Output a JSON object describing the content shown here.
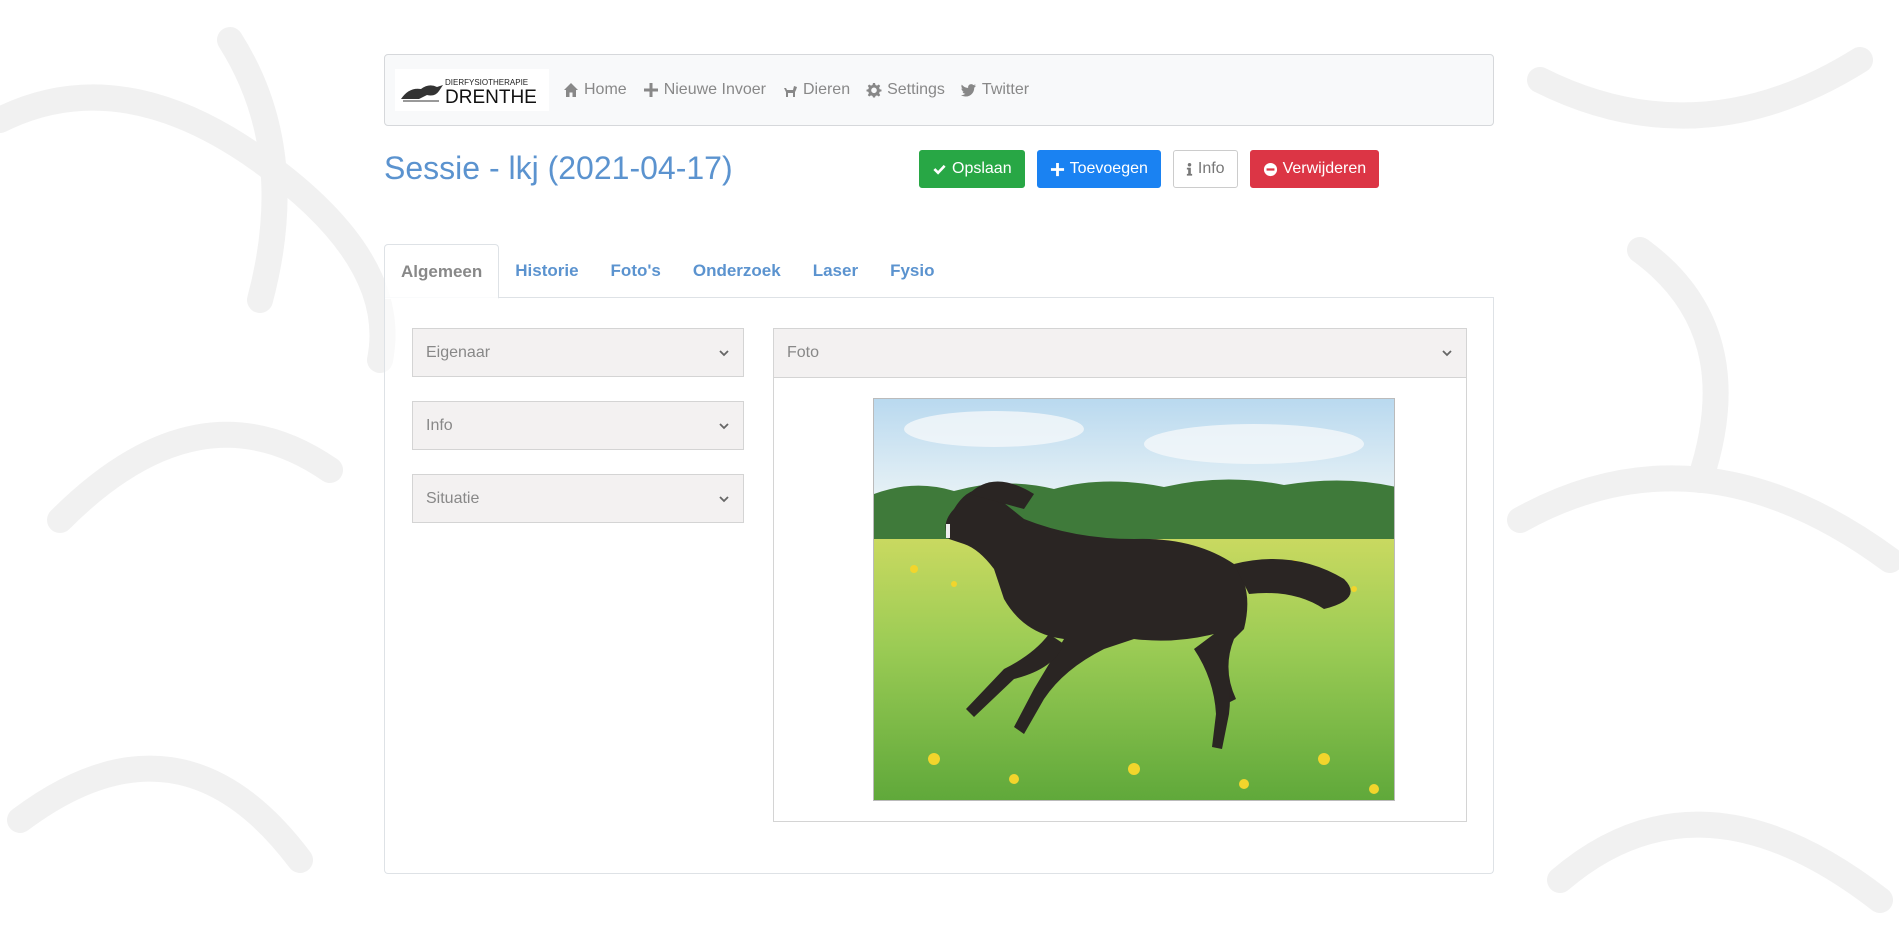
{
  "brand": {
    "line1": "DIERFYSIOTHERAPIE",
    "line2": "DRENTHE"
  },
  "nav": [
    {
      "label": "Home",
      "icon": "home-icon"
    },
    {
      "label": "Nieuwe Invoer",
      "icon": "plus-icon"
    },
    {
      "label": "Dieren",
      "icon": "dog-icon"
    },
    {
      "label": "Settings",
      "icon": "gear-icon"
    },
    {
      "label": "Twitter",
      "icon": "twitter-icon"
    }
  ],
  "page": {
    "title": "Sessie - lkj (2021-04-17)"
  },
  "actions": {
    "save": "Opslaan",
    "add": "Toevoegen",
    "info": "Info",
    "delete": "Verwijderen"
  },
  "tabs": [
    "Algemeen",
    "Historie",
    "Foto's",
    "Onderzoek",
    "Laser",
    "Fysio"
  ],
  "active_tab": "Algemeen",
  "accordions": [
    "Eigenaar",
    "Info",
    "Situatie"
  ],
  "foto": {
    "header": "Foto"
  },
  "colors": {
    "title": "#5b93cf",
    "success": "#28a745",
    "primary": "#1a82f2",
    "danger": "#dc3545"
  }
}
